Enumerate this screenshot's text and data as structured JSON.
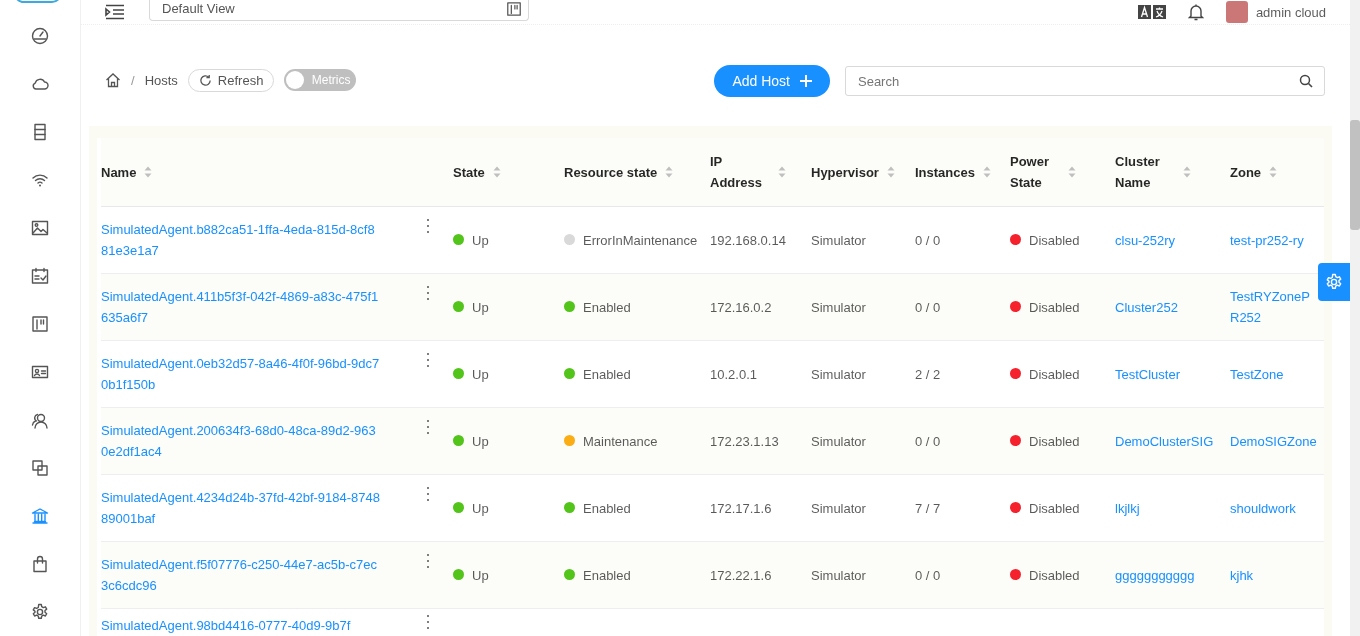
{
  "header": {
    "view_selector": {
      "value": "Default View"
    },
    "user": {
      "name": "admin cloud"
    }
  },
  "sidebar": {
    "items": [
      {
        "kind": "dashboard",
        "selected": false
      },
      {
        "kind": "cloud",
        "selected": false
      },
      {
        "kind": "server",
        "selected": false
      },
      {
        "kind": "wifi",
        "selected": false
      },
      {
        "kind": "image",
        "selected": false
      },
      {
        "kind": "calendar",
        "selected": false
      },
      {
        "kind": "board",
        "selected": false
      },
      {
        "kind": "idcard",
        "selected": false
      },
      {
        "kind": "users",
        "selected": false
      },
      {
        "kind": "copy",
        "selected": false
      },
      {
        "kind": "bank",
        "selected": true
      },
      {
        "kind": "bag",
        "selected": false
      },
      {
        "kind": "gear",
        "selected": false
      }
    ]
  },
  "toolbar": {
    "breadcrumb_separator": "/",
    "breadcrumb": [
      "Hosts"
    ],
    "refresh": "Refresh",
    "metrics": {
      "label": "Metrics",
      "on": false
    },
    "add_button": "Add Host",
    "search": {
      "placeholder": "Search"
    }
  },
  "table": {
    "columns": [
      {
        "label": "Name",
        "sortable": true
      },
      {
        "label": "State",
        "sortable": true
      },
      {
        "label": "Resource state",
        "sortable": true
      },
      {
        "label": "IP Address",
        "sortable": true
      },
      {
        "label": "Hypervisor",
        "sortable": true
      },
      {
        "label": "Instances",
        "sortable": true
      },
      {
        "label": "Power State",
        "sortable": true
      },
      {
        "label": "Cluster Name",
        "sortable": true
      },
      {
        "label": "Zone",
        "sortable": true
      }
    ],
    "rows": [
      {
        "name": "SimulatedAgent.b882ca51-1ffa-4eda-815d-8cf881e3e1a7",
        "state": {
          "label": "Up",
          "color": "#52c41a"
        },
        "resource_state": {
          "label": "ErrorInMaintenance",
          "color": "#d9d9d9"
        },
        "ip": "192.168.0.14",
        "hypervisor": "Simulator",
        "instances": "0 / 0",
        "power_state": {
          "label": "Disabled",
          "color": "#f5222d"
        },
        "cluster": "clsu-252ry",
        "zone": "test-pr252-ry"
      },
      {
        "name": "SimulatedAgent.411b5f3f-042f-4869-a83c-475f1635a6f7",
        "state": {
          "label": "Up",
          "color": "#52c41a"
        },
        "resource_state": {
          "label": "Enabled",
          "color": "#52c41a"
        },
        "ip": "172.16.0.2",
        "hypervisor": "Simulator",
        "instances": "0 / 0",
        "power_state": {
          "label": "Disabled",
          "color": "#f5222d"
        },
        "cluster": "Cluster252",
        "zone": "TestRYZonePR252"
      },
      {
        "name": "SimulatedAgent.0eb32d57-8a46-4f0f-96bd-9dc70b1f150b",
        "state": {
          "label": "Up",
          "color": "#52c41a"
        },
        "resource_state": {
          "label": "Enabled",
          "color": "#52c41a"
        },
        "ip": "10.2.0.1",
        "hypervisor": "Simulator",
        "instances": "2 / 2",
        "power_state": {
          "label": "Disabled",
          "color": "#f5222d"
        },
        "cluster": "TestCluster",
        "zone": "TestZone"
      },
      {
        "name": "SimulatedAgent.200634f3-68d0-48ca-89d2-9630e2df1ac4",
        "state": {
          "label": "Up",
          "color": "#52c41a"
        },
        "resource_state": {
          "label": "Maintenance",
          "color": "#faad14"
        },
        "ip": "172.23.1.13",
        "hypervisor": "Simulator",
        "instances": "0 / 0",
        "power_state": {
          "label": "Disabled",
          "color": "#f5222d"
        },
        "cluster": "DemoClusterSIG",
        "zone": "DemoSIGZone"
      },
      {
        "name": "SimulatedAgent.4234d24b-37fd-42bf-9184-874889001baf",
        "state": {
          "label": "Up",
          "color": "#52c41a"
        },
        "resource_state": {
          "label": "Enabled",
          "color": "#52c41a"
        },
        "ip": "172.17.1.6",
        "hypervisor": "Simulator",
        "instances": "7 / 7",
        "power_state": {
          "label": "Disabled",
          "color": "#f5222d"
        },
        "cluster": "lkjlkj",
        "zone": "shouldwork"
      },
      {
        "name": "SimulatedAgent.f5f07776-c250-44e7-ac5b-c7ec3c6cdc96",
        "state": {
          "label": "Up",
          "color": "#52c41a"
        },
        "resource_state": {
          "label": "Enabled",
          "color": "#52c41a"
        },
        "ip": "172.22.1.6",
        "hypervisor": "Simulator",
        "instances": "0 / 0",
        "power_state": {
          "label": "Disabled",
          "color": "#f5222d"
        },
        "cluster": "ggggggggggg",
        "zone": "kjhk"
      },
      {
        "name": "SimulatedAgent.98bd4416-0777-40d9-9b7f"
      }
    ]
  }
}
